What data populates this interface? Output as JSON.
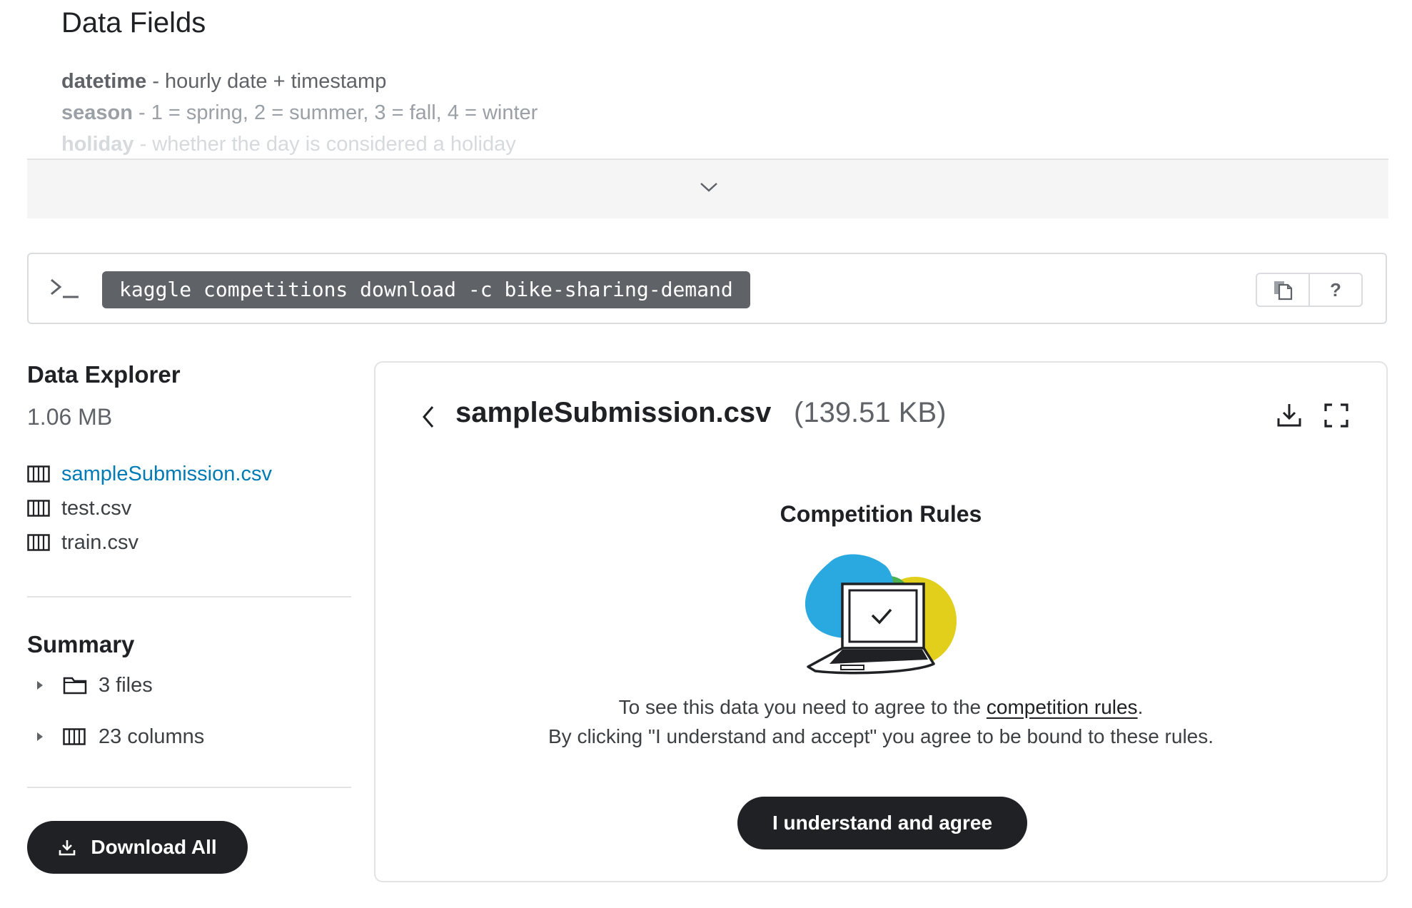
{
  "data_fields": {
    "title": "Data Fields",
    "fields": [
      {
        "key": "datetime",
        "desc": " - hourly date + timestamp"
      },
      {
        "key": "season",
        "desc": " -  1 = spring, 2 = summer, 3 = fall, 4 = winter"
      },
      {
        "key": "holiday",
        "desc": " - whether the day is considered a holiday"
      }
    ],
    "expand_icon": "chevron-down-icon"
  },
  "api": {
    "command": "kaggle competitions download -c bike-sharing-demand",
    "prompt_icon": "terminal-icon",
    "copy_icon": "copy-icon",
    "help_label": "?"
  },
  "explorer": {
    "title": "Data Explorer",
    "size": "1.06 MB",
    "files": [
      {
        "name": "sampleSubmission.csv",
        "active": true
      },
      {
        "name": "test.csv",
        "active": false
      },
      {
        "name": "train.csv",
        "active": false
      }
    ]
  },
  "summary": {
    "title": "Summary",
    "files_label": "3 files",
    "columns_label": "23 columns"
  },
  "download_all_label": "Download All",
  "preview": {
    "file_name": "sampleSubmission.csv",
    "file_size": "(139.51 KB)",
    "rules_title": "Competition Rules",
    "line1_prefix": "To see this data you need to agree to the ",
    "line1_link": "competition rules",
    "line1_suffix": ".",
    "line2": "By clicking \"I understand and accept\" you agree to be bound to these rules.",
    "agree_label": "I understand and agree"
  },
  "colors": {
    "accent_link": "#007bb6",
    "button_dark": "#202124",
    "code_bg": "#5f6368",
    "illustration_blue": "#2aa8e0",
    "illustration_green": "#4caf50",
    "illustration_yellow": "#e2cf1b"
  }
}
